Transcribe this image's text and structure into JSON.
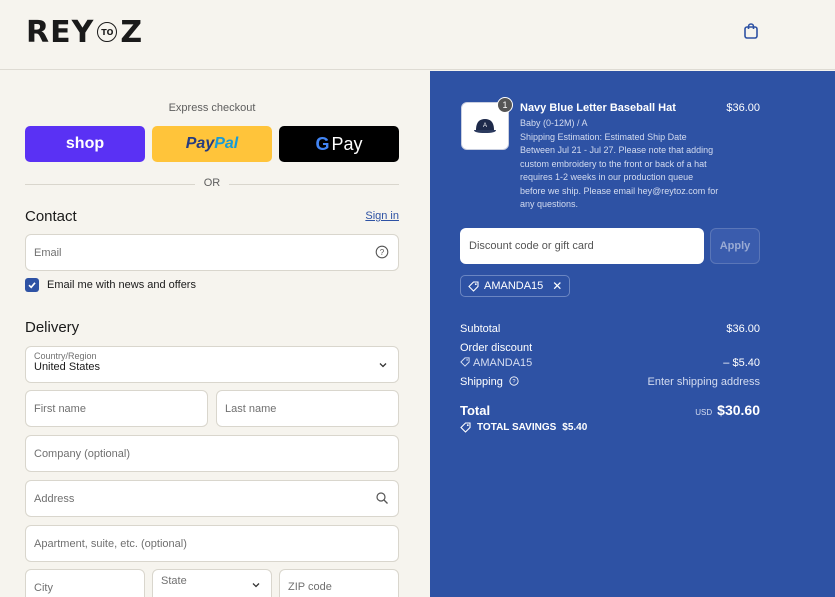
{
  "header": {
    "logo_left": "REY",
    "logo_mid": "TO",
    "logo_right": "Z"
  },
  "express": {
    "title": "Express checkout",
    "shop_label": "shop",
    "paypal_part1": "Pay",
    "paypal_part2": "Pal",
    "gpay_g": "G",
    "gpay_label": "Pay",
    "or_label": "OR"
  },
  "contact": {
    "heading": "Contact",
    "signin_label": "Sign in",
    "email_placeholder": "Email",
    "newsletter_label": "Email me with news and offers",
    "newsletter_checked": true
  },
  "delivery": {
    "heading": "Delivery",
    "country_label": "Country/Region",
    "country_value": "United States",
    "first_name": "First name",
    "last_name": "Last name",
    "company": "Company (optional)",
    "address": "Address",
    "apartment": "Apartment, suite, etc. (optional)",
    "city": "City",
    "state": "State",
    "zip": "ZIP code"
  },
  "order": {
    "product": {
      "quantity": "1",
      "name": "Navy Blue Letter Baseball Hat",
      "price": "$36.00",
      "variant": "Baby (0-12M) / A",
      "shipping_note": "Shipping Estimation: Estimated Ship Date Between Jul 21 - Jul 27. Please note that adding custom embroidery to the front or back of a hat requires 1-2 weeks in our production queue before we ship. Please email hey@reytoz.com for any questions."
    },
    "discount_placeholder": "Discount code or gift card",
    "apply_label": "Apply",
    "applied_code": "AMANDA15",
    "summary": {
      "subtotal_label": "Subtotal",
      "subtotal_value": "$36.00",
      "order_discount_label": "Order discount",
      "discount_code": "AMANDA15",
      "discount_value": "– $5.40",
      "shipping_label": "Shipping",
      "shipping_value": "Enter shipping address",
      "total_label": "Total",
      "currency": "USD",
      "total_value": "$30.60",
      "savings_label": "TOTAL SAVINGS",
      "savings_value": "$5.40"
    }
  },
  "colors": {
    "accent": "#2e52a4",
    "shop_purple": "#5a31f4",
    "paypal_yellow": "#ffc43a"
  }
}
